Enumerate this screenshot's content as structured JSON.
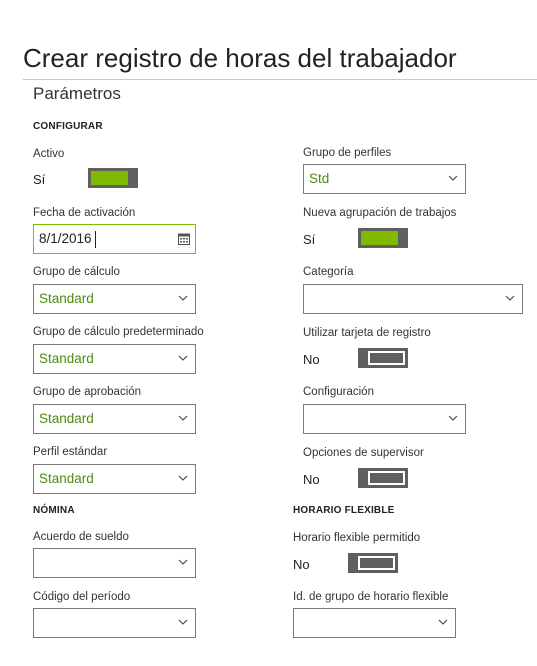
{
  "page": {
    "title": "Crear registro de horas del trabajador"
  },
  "section": {
    "title": "Parámetros"
  },
  "configurar": {
    "heading": "CONFIGURAR",
    "activo": {
      "label": "Activo",
      "value": "Sí",
      "state": "on"
    },
    "fecha_activacion": {
      "label": "Fecha de activación",
      "value": "8/1/2016"
    },
    "grupo_calculo": {
      "label": "Grupo de cálculo",
      "value": "Standard"
    },
    "grupo_calculo_pred": {
      "label": "Grupo de cálculo predeterminado",
      "value": "Standard"
    },
    "grupo_aprobacion": {
      "label": "Grupo de aprobación",
      "value": "Standard"
    },
    "perfil_estandar": {
      "label": "Perfil estándar",
      "value": "Standard"
    },
    "grupo_perfiles": {
      "label": "Grupo de perfiles",
      "value": "Std"
    },
    "nueva_agrupacion": {
      "label": "Nueva agrupación de trabajos",
      "value": "Sí",
      "state": "on"
    },
    "categoria": {
      "label": "Categoría",
      "value": ""
    },
    "tarjeta_registro": {
      "label": "Utilizar tarjeta de registro",
      "value": "No",
      "state": "off"
    },
    "configuracion": {
      "label": "Configuración",
      "value": ""
    },
    "opciones_supervisor": {
      "label": "Opciones de supervisor",
      "value": "No",
      "state": "off"
    }
  },
  "nomina": {
    "heading": "NÓMINA",
    "acuerdo_sueldo": {
      "label": "Acuerdo de sueldo",
      "value": ""
    },
    "codigo_periodo": {
      "label": "Código del período",
      "value": ""
    }
  },
  "horario_flexible": {
    "heading": "HORARIO FLEXIBLE",
    "permitido": {
      "label": "Horario flexible permitido",
      "value": "No",
      "state": "off"
    },
    "id_grupo": {
      "label": "Id. de grupo de horario flexible",
      "value": ""
    }
  },
  "colors": {
    "accent": "#7fba00",
    "toggle_dark": "#5f5f5f",
    "select_value": "#4f8a10",
    "border": "#7a7a7a"
  },
  "icons": {
    "dropdown": "chevron-down-icon",
    "calendar": "calendar-icon"
  }
}
